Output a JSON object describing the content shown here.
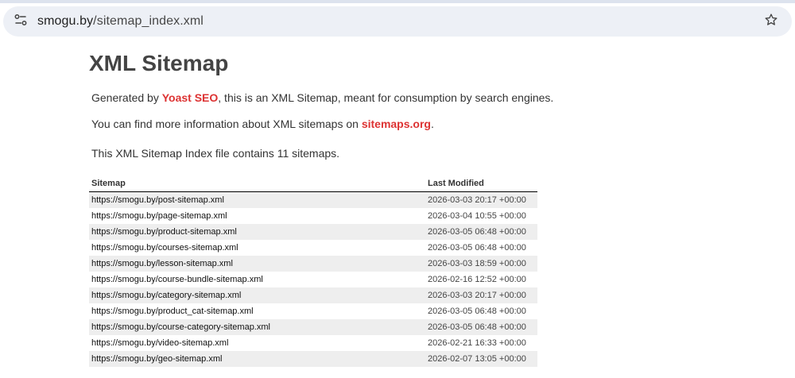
{
  "browser": {
    "url_host": "smogu.by",
    "url_path": "/sitemap_index.xml",
    "site_info_icon": "tune-icon",
    "bookmark_icon": "star-icon"
  },
  "page": {
    "title": "XML Sitemap",
    "intro_prefix": "Generated by ",
    "intro_link": "Yoast SEO",
    "intro_suffix": ", this is an XML Sitemap, meant for consumption by search engines.",
    "info_prefix": "You can find more information about XML sitemaps on ",
    "info_link": "sitemaps.org",
    "info_suffix": ".",
    "count_text": "This XML Sitemap Index file contains 11 sitemaps.",
    "link_color": "#dd3333"
  },
  "table": {
    "headers": {
      "sitemap": "Sitemap",
      "last_modified": "Last Modified"
    },
    "rows": [
      {
        "loc": "https://smogu.by/post-sitemap.xml",
        "lastmod": "2026-03-03 20:17 +00:00"
      },
      {
        "loc": "https://smogu.by/page-sitemap.xml",
        "lastmod": "2026-03-04 10:55 +00:00"
      },
      {
        "loc": "https://smogu.by/product-sitemap.xml",
        "lastmod": "2026-03-05 06:48 +00:00"
      },
      {
        "loc": "https://smogu.by/courses-sitemap.xml",
        "lastmod": "2026-03-05 06:48 +00:00"
      },
      {
        "loc": "https://smogu.by/lesson-sitemap.xml",
        "lastmod": "2026-03-03 18:59 +00:00"
      },
      {
        "loc": "https://smogu.by/course-bundle-sitemap.xml",
        "lastmod": "2026-02-16 12:52 +00:00"
      },
      {
        "loc": "https://smogu.by/category-sitemap.xml",
        "lastmod": "2026-03-03 20:17 +00:00"
      },
      {
        "loc": "https://smogu.by/product_cat-sitemap.xml",
        "lastmod": "2026-03-05 06:48 +00:00"
      },
      {
        "loc": "https://smogu.by/course-category-sitemap.xml",
        "lastmod": "2026-03-05 06:48 +00:00"
      },
      {
        "loc": "https://smogu.by/video-sitemap.xml",
        "lastmod": "2026-02-21 16:33 +00:00"
      },
      {
        "loc": "https://smogu.by/geo-sitemap.xml",
        "lastmod": "2026-02-07 13:05 +00:00"
      }
    ]
  }
}
